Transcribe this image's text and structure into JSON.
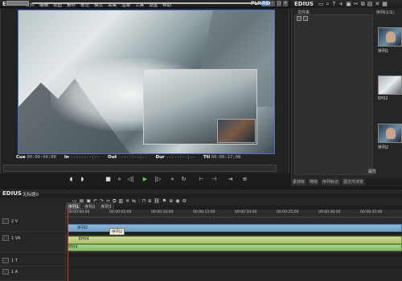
{
  "app": {
    "logo": "EDIUS",
    "menu": [
      "文件",
      "编辑",
      "视图",
      "素材",
      "标记",
      "模式",
      "采集",
      "渲染",
      "工具",
      "设置",
      "帮助"
    ],
    "plr": "PLR",
    "rec": "REC"
  },
  "player": {
    "timecodes": [
      {
        "label": "Cue",
        "value": "00:00:00;00"
      },
      {
        "label": "In",
        "value": "--:--:--;--"
      },
      {
        "label": "Out",
        "value": "--:--:--;--"
      },
      {
        "label": "Dur",
        "value": "--:--:--;--"
      },
      {
        "label": "Ttl",
        "value": "00:00:17;08"
      }
    ]
  },
  "bin": {
    "logo": "EDIUS",
    "tree_label": "文件夹",
    "list_label": "序列(1/1)",
    "items": [
      {
        "caption": "序列1"
      },
      {
        "caption": "EP02"
      },
      {
        "caption": "序列2"
      }
    ],
    "property_label": "属性",
    "tabs": [
      "素材库",
      "特效",
      "序列标记",
      "源文件浏览"
    ]
  },
  "timeline": {
    "logo": "EDIUS",
    "project": "无标题0",
    "sequence_tabs": [
      "序列1",
      "序列2",
      "序列3"
    ],
    "ruler_ticks": [
      "00:00:00;00",
      "00:00:05;00",
      "00:00:10;00",
      "00:00:15;00",
      "00:00:20;00",
      "00:00:25;00",
      "00:00:30;00",
      "00:00:35;00"
    ],
    "tracks": [
      {
        "name": "2 V"
      },
      {
        "name": "1 VA"
      },
      {
        "name": "1 T"
      },
      {
        "name": "1 A"
      }
    ],
    "clips": {
      "seq2": "序列2",
      "ep04_video": "EP04",
      "ep04_audio": "EP04"
    },
    "tooltip": "序列2"
  }
}
